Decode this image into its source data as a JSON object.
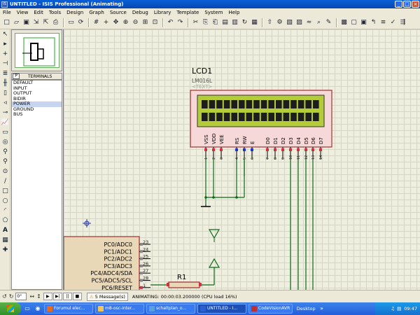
{
  "window": {
    "title": "UNTITLED - ISIS Professional (Animating)",
    "app_icon": "isis-icon"
  },
  "menu": [
    "File",
    "View",
    "Edit",
    "Tools",
    "Design",
    "Graph",
    "Source",
    "Debug",
    "Library",
    "Template",
    "System",
    "Help"
  ],
  "toolbar": {
    "icons": [
      "new-icon",
      "open-icon",
      "save-icon",
      "import-icon",
      "export-icon",
      "print-icon",
      "area-icon",
      "refresh-icon",
      "grid-icon",
      "origin-icon",
      "pan-icon",
      "zoom-in-icon",
      "zoom-out-icon",
      "zoom-all-icon",
      "zoom-area-icon",
      "undo-icon",
      "redo-icon",
      "cut-icon",
      "copy-icon",
      "paste-icon",
      "block-copy-icon",
      "block-move-icon",
      "block-rotate-icon",
      "block-delete-icon",
      "pick-icon",
      "make-device-icon",
      "packaging-icon",
      "decompose-icon",
      "wire-autorouter-icon",
      "search-icon",
      "property-icon",
      "design-explorer-icon",
      "new-sheet-icon",
      "remove-sheet-icon",
      "exit-to-parent-icon",
      "bill-of-materials-icon",
      "electrical-rule-check-icon",
      "netlist-icon"
    ]
  },
  "left_tools": [
    "selection-icon",
    "component-icon",
    "junction-icon",
    "wire-label-icon",
    "text-script-icon",
    "bus-icon",
    "subcircuit-icon",
    "terminal-icon",
    "device-pin-icon",
    "graph-icon",
    "tape-icon",
    "generator-icon",
    "voltage-probe-icon",
    "current-probe-icon",
    "virtual-instrument-icon",
    "line-icon",
    "box-icon",
    "circle-icon",
    "arc-icon",
    "path-icon",
    "text-icon",
    "symbol-icon",
    "marker-icon"
  ],
  "devices": {
    "panel_button": "P",
    "header": "TERMINALS",
    "items": [
      "DEFAULT",
      "INPUT",
      "OUTPUT",
      "BIDIR",
      "POWER",
      "GROUND",
      "BUS"
    ],
    "selected": "POWER"
  },
  "schematic": {
    "lcd_ref": "LCD1",
    "lcd_model": "LM016L",
    "lcd_text": "<TEXT>",
    "lcd_pins": [
      "VSS",
      "VDD",
      "VEE",
      "RS",
      "RW",
      "E",
      "D0",
      "D1",
      "D2",
      "D3",
      "D4",
      "D5",
      "D6",
      "D7"
    ],
    "lcd_pin_numbers": [
      "1",
      "2",
      "3",
      "4",
      "5",
      "6",
      "7",
      "8",
      "9",
      "10",
      "11",
      "12",
      "13",
      "14"
    ],
    "mcu_pins": [
      "PC0/ADC0",
      "PC1/ADC1",
      "PC2/ADC2",
      "PC3/ADC3",
      "PC4/ADC4/SDA",
      "PC5/ADC5/SCL",
      "PC6/RESET"
    ],
    "mcu_pin_numbers": [
      "23",
      "24",
      "25",
      "26",
      "27",
      "28",
      "1"
    ],
    "resistor_ref": "R1"
  },
  "bottom": {
    "rotation": "0°",
    "messages": "5 Message(s)",
    "status": "ANIMATING: 00:00:03.200000 (CPU load 16%)"
  },
  "taskbar": {
    "tasks": [
      {
        "label": "Forumul elec...",
        "icon": "firefox-icon"
      },
      {
        "label": "m8-osc-inter...",
        "icon": "folder-icon"
      },
      {
        "label": "schaltplan_o...",
        "icon": "paint-icon"
      },
      {
        "label": "UNTITLED - I...",
        "icon": "isis-icon"
      },
      {
        "label": "CodeVisionAVR",
        "icon": "cv-icon"
      }
    ],
    "desktop": "Desktop",
    "clock": "09:47"
  }
}
